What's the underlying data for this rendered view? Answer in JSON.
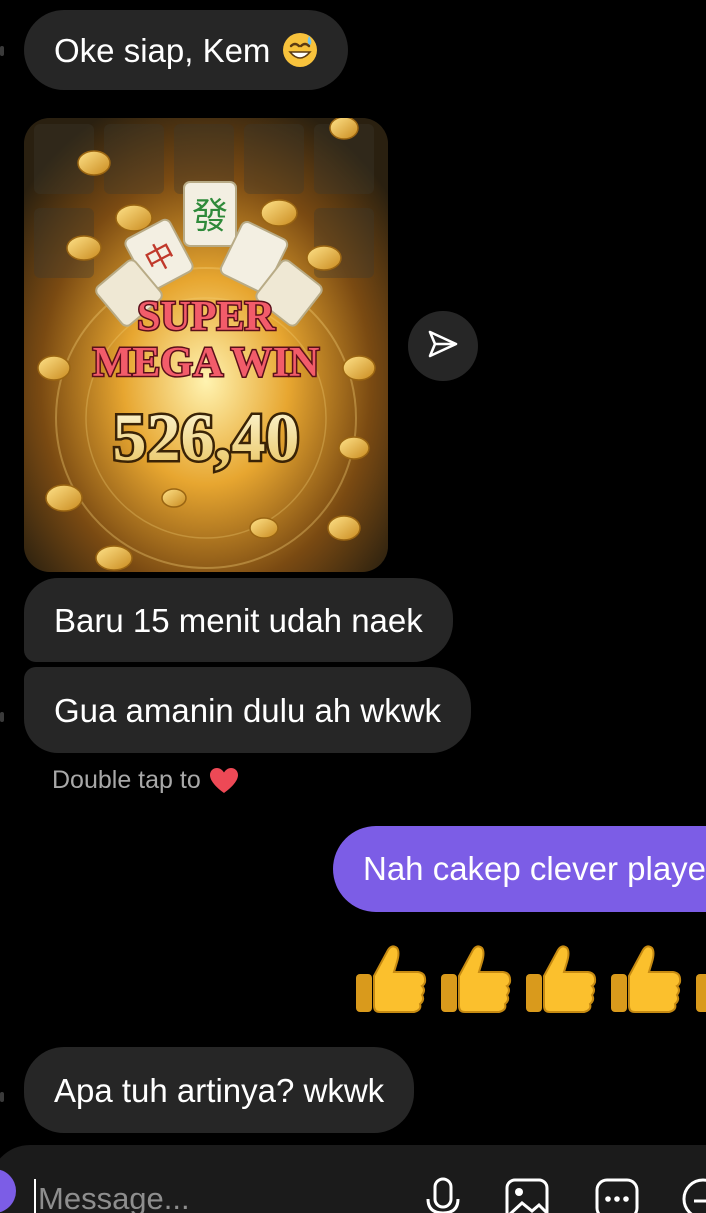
{
  "messages": {
    "m1": {
      "text": "Oke siap, Kem",
      "emoji": "grinning-sweat-emoji"
    },
    "image": {
      "title_line1": "SUPER",
      "title_line2": "MEGA WIN",
      "amount": "526,40",
      "tile_char": "發",
      "tile_char2": "中"
    },
    "m2": {
      "text": "Baru 15 menit udah naek"
    },
    "m3": {
      "text": "Gua amanin dulu ah wkwk"
    },
    "reaction_hint": "Double tap to",
    "sent": {
      "text": "Nah cakep clever player"
    },
    "m5": {
      "text": "Apa tuh artinya? wkwk"
    }
  },
  "composer": {
    "placeholder": "Message..."
  },
  "icons": {
    "share": "send-arrow-icon",
    "heart": "heart-icon",
    "mic": "microphone-icon",
    "gallery": "image-gallery-icon",
    "more": "chat-bubble-more-icon",
    "sticker": "sticker-icon"
  },
  "colors": {
    "background": "#000000",
    "received_bubble": "#262626",
    "sent_bubble": "#7c5de6",
    "hint_text": "#a8a8a8",
    "heart": "#ed4956"
  }
}
